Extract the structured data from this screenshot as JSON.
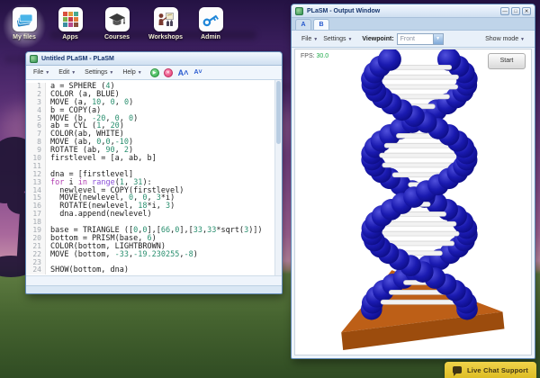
{
  "desktop": {
    "icons": [
      {
        "name": "my-files",
        "label": "My files",
        "icon": "folders-icon",
        "selected": true
      },
      {
        "name": "apps",
        "label": "Apps",
        "icon": "app-grid-icon",
        "selected": false
      },
      {
        "name": "courses",
        "label": "Courses",
        "icon": "mortarboard-icon",
        "selected": false
      },
      {
        "name": "workshops",
        "label": "Workshops",
        "icon": "presenter-icon",
        "selected": false
      },
      {
        "name": "admin",
        "label": "Admin",
        "icon": "key-icon",
        "selected": false
      }
    ]
  },
  "editor_window": {
    "title": "Untitled PLaSM - PLaSM",
    "menus": [
      "File",
      "Edit",
      "Settings",
      "Help"
    ],
    "toolbar_icons": [
      "run-icon",
      "stop-icon",
      "font-increase-icon",
      "font-decrease-icon"
    ],
    "code_lines": [
      "a = SPHERE (4)",
      "COLOR (a, BLUE)",
      "MOVE (a, 10, 0, 0)",
      "b = COPY(a)",
      "MOVE (b, -20, 0, 0)",
      "ab = CYL (1, 20)",
      "COLOR(ab, WHITE)",
      "MOVE (ab, 0,0,-10)",
      "ROTATE (ab, 90, 2)",
      "firstlevel = [a, ab, b]",
      "",
      "dna = [firstlevel]",
      "for i in range(1, 31):",
      "  newlevel = COPY(firstlevel)",
      "  MOVE(newlevel, 0, 0, 3*i)",
      "  ROTATE(newlevel, 18*i, 3)",
      "  dna.append(newlevel)",
      "",
      "base = TRIANGLE ([0,0],[66,0],[33,33*sqrt(3)])",
      "bottom = PRISM(base, 6)",
      "COLOR(bottom, LIGHTBROWN)",
      "MOVE (bottom, -33,-19.230255,-8)",
      "",
      "SHOW(bottom, dna)"
    ]
  },
  "output_window": {
    "title": "PLaSM - Output Window",
    "window_control_icons": [
      "minimize-icon",
      "maximize-icon",
      "close-icon"
    ],
    "tabs": [
      "A",
      "B"
    ],
    "active_tab": "B",
    "menus": [
      "File",
      "Settings"
    ],
    "viewpoint_label": "Viewpoint:",
    "viewpoint_value": "Front",
    "show_mode_label": "Show mode",
    "fps_label": "FPS:",
    "fps_value": "30.0",
    "start_button_label": "Start"
  },
  "chat": {
    "label": "Live Chat Support"
  },
  "colors": {
    "dna_blue": "#1a1ab0",
    "dna_blue_light": "#5050dc",
    "dna_blue_dark": "#0b0b80",
    "rung_white": "#f2f2f2",
    "base_top": "#bd5f17",
    "base_front": "#9c4c0d",
    "fps_green": "#1faa4a",
    "chat_yellow": "#e9c838",
    "number_teal": "#2a8f6f",
    "keyword_purple": "#b03cb0",
    "function_purple": "#8a50d8"
  }
}
